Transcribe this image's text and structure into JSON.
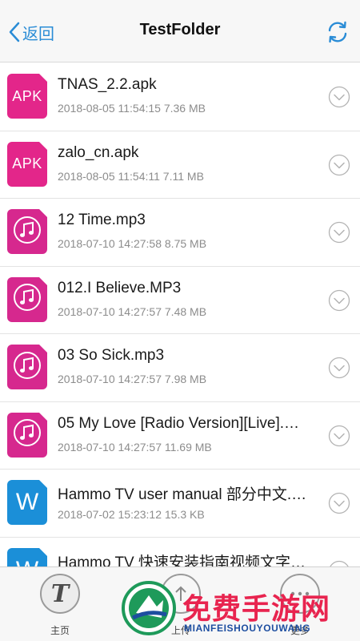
{
  "header": {
    "back_label": "返回",
    "title": "TestFolder"
  },
  "files": [
    {
      "icon": "apk-file-icon",
      "type_label": "APK",
      "name": "TNAS_2.2.apk",
      "meta": "2018-08-05 11:54:15 7.36 MB"
    },
    {
      "icon": "apk-file-icon",
      "type_label": "APK",
      "name": "zalo_cn.apk",
      "meta": "2018-08-05 11:54:11 7.11 MB"
    },
    {
      "icon": "music-file-icon",
      "type_label": "",
      "name": "12 Time.mp3",
      "meta": "2018-07-10 14:27:58 8.75 MB"
    },
    {
      "icon": "music-file-icon",
      "type_label": "",
      "name": "012.I Believe.MP3",
      "meta": "2018-07-10 14:27:57 7.48 MB"
    },
    {
      "icon": "music-file-icon",
      "type_label": "",
      "name": "03 So Sick.mp3",
      "meta": "2018-07-10 14:27:57 7.98 MB"
    },
    {
      "icon": "music-file-icon",
      "type_label": "",
      "name": "05 My Love [Radio Version][Live].…",
      "meta": "2018-07-10 14:27:57 11.69 MB"
    },
    {
      "icon": "word-file-icon",
      "type_label": "W",
      "name": "Hammo TV user manual 部分中文.…",
      "meta": "2018-07-02 15:23:12 15.3 KB"
    },
    {
      "icon": "word-file-icon",
      "type_label": "W",
      "name": "Hammo TV 快速安装指南视频文字…",
      "meta": ""
    }
  ],
  "tabbar": {
    "home_label": "主页",
    "upload_label": "上传",
    "more_label": "更多"
  },
  "watermark": {
    "title": "免费手游网",
    "subtitle": "MIANFEISHOUYOUWANG"
  },
  "colors": {
    "accent": "#2a8cd6",
    "apk": "#e3268a",
    "music": "#d6288e",
    "word": "#1b8fd8"
  }
}
